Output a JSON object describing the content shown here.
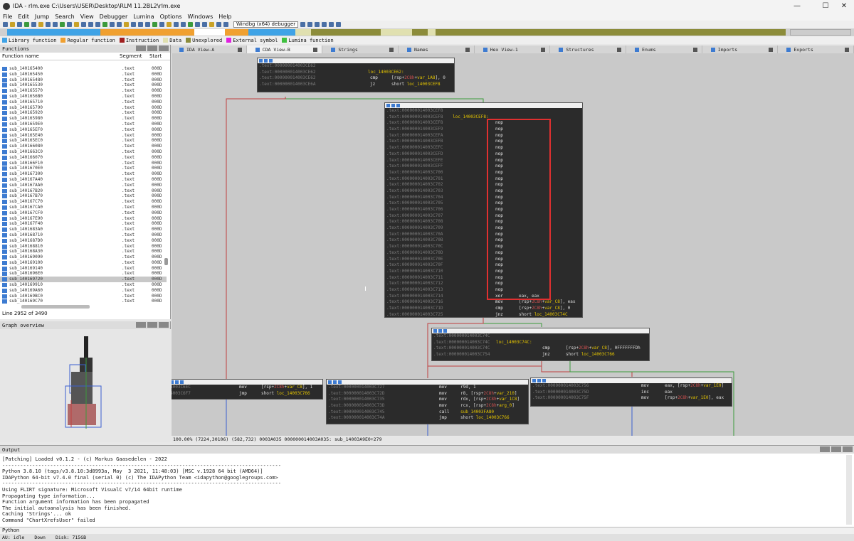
{
  "window": {
    "title": "IDA - rlm.exe C:\\Users\\USER\\Desktop\\RLM 11.2BL2\\rlm.exe",
    "min": "—",
    "max": "☐",
    "close": "✕"
  },
  "menu": [
    "File",
    "Edit",
    "Jump",
    "Search",
    "View",
    "Debugger",
    "Lumina",
    "Options",
    "Windows",
    "Help"
  ],
  "toolbar": {
    "debugger": "Windbg (x64) debugger"
  },
  "legend": [
    {
      "label": "Library function",
      "color": "#3fa3e6"
    },
    {
      "label": "Regular function",
      "color": "#f0a030"
    },
    {
      "label": "Instruction",
      "color": "#a02020"
    },
    {
      "label": "Data",
      "color": "#e0e0b0"
    },
    {
      "label": "Unexplored",
      "color": "#8c8c3a"
    },
    {
      "label": "External symbol",
      "color": "#e020e0"
    },
    {
      "label": "Lumina function",
      "color": "#40c040"
    }
  ],
  "navbar_segments": [
    {
      "w": 12,
      "c": "#3fa3e6"
    },
    {
      "w": 12,
      "c": "#f0a030"
    },
    {
      "w": 4,
      "c": "#ffffff"
    },
    {
      "w": 3,
      "c": "#f0a030"
    },
    {
      "w": 6,
      "c": "#3fa3e6"
    },
    {
      "w": 2,
      "c": "#e0e0b0"
    },
    {
      "w": 9,
      "c": "#8c8c3a"
    },
    {
      "w": 4,
      "c": "#e0e0b0"
    },
    {
      "w": 2,
      "c": "#8c8c3a"
    },
    {
      "w": 1,
      "c": "#e0e0b0"
    },
    {
      "w": 45,
      "c": "#8c8c3a"
    }
  ],
  "tabs": [
    "IDA View-A",
    "CDA View-B",
    "Strings",
    "Names",
    "Hex View-1",
    "Structures",
    "Enums",
    "Imports",
    "Exports"
  ],
  "functions": {
    "title": "Functions",
    "cols": [
      "Function name",
      "Segment",
      "Start"
    ],
    "rows": [
      "sub_140165400",
      "sub_140165450",
      "sub_140165480",
      "sub_140165530",
      "sub_140165570",
      "sub_1401656B0",
      "sub_140165710",
      "sub_140165790",
      "sub_140165920",
      "sub_140165980",
      "sub_1401659E0",
      "sub_140165EF0",
      "sub_140165E40",
      "sub_140165EC0",
      "sub_140166080",
      "sub_1401663C0",
      "sub_140166070",
      "sub_140166F10",
      "sub_1401670E0",
      "sub_140167300",
      "sub_140167A40",
      "sub_140167AA0",
      "sub_140167B20",
      "sub_140167B70",
      "sub_140167C70",
      "sub_140167CA0",
      "sub_140167CF0",
      "sub_140167E90",
      "sub_140167F40",
      "sub_1401683A0",
      "sub_140168710",
      "sub_1401687D0",
      "sub_140168810",
      "sub_140168A30",
      "sub_140169090",
      "sub_140169100",
      "sub_140169140",
      "sub_1401696E0",
      "sub_140169720",
      "sub_140169910",
      "sub_140169A60",
      "sub_140169BC0",
      "sub_140169C70"
    ],
    "segment": ".text",
    "start": "000D",
    "selected": 38,
    "status": "Line 2952 of 3490"
  },
  "graph_overview": {
    "title": "Graph overview"
  },
  "blocks": [
    {
      "id": "b1",
      "lines": [
        {
          "addr": ".text:000000014003CE62"
        },
        {
          "addr": ".text:000000014003CE62",
          "label": "loc_14003CE62:"
        },
        {
          "addr": ".text:000000014003CE62",
          "mn": "cmp",
          "op": "[rsp+2C8h+var_1A8], 0"
        },
        {
          "addr": ".text:000000014003CE6A",
          "mn": "jz",
          "op": "short loc_14003CEF8"
        }
      ]
    },
    {
      "id": "b2",
      "lines": [
        {
          "addr": ".text:000000014003CEF8"
        },
        {
          "addr": ".text:000000014003CEF8",
          "label": "loc_14003CEF8:"
        },
        {
          "addr": ".text:000000014003CEF8",
          "mn": "nop"
        },
        {
          "addr": ".text:000000014003CEF9",
          "mn": "nop"
        },
        {
          "addr": ".text:000000014003CEFA",
          "mn": "nop"
        },
        {
          "addr": ".text:000000014003CEFB",
          "mn": "nop"
        },
        {
          "addr": ".text:000000014003CEFC",
          "mn": "nop"
        },
        {
          "addr": ".text:000000014003CEFD",
          "mn": "nop"
        },
        {
          "addr": ".text:000000014003CEFE",
          "mn": "nop"
        },
        {
          "addr": ".text:000000014003CEFF",
          "mn": "nop"
        },
        {
          "addr": ".text:000000014003C700",
          "mn": "nop"
        },
        {
          "addr": ".text:000000014003C701",
          "mn": "nop"
        },
        {
          "addr": ".text:000000014003C702",
          "mn": "nop"
        },
        {
          "addr": ".text:000000014003C703",
          "mn": "nop"
        },
        {
          "addr": ".text:000000014003C704",
          "mn": "nop"
        },
        {
          "addr": ".text:000000014003C705",
          "mn": "nop"
        },
        {
          "addr": ".text:000000014003C706",
          "mn": "nop"
        },
        {
          "addr": ".text:000000014003C707",
          "mn": "nop"
        },
        {
          "addr": ".text:000000014003C708",
          "mn": "nop"
        },
        {
          "addr": ".text:000000014003C709",
          "mn": "nop"
        },
        {
          "addr": ".text:000000014003C70A",
          "mn": "nop"
        },
        {
          "addr": ".text:000000014003C70B",
          "mn": "nop"
        },
        {
          "addr": ".text:000000014003C70C",
          "mn": "nop"
        },
        {
          "addr": ".text:000000014003C70D",
          "mn": "nop"
        },
        {
          "addr": ".text:000000014003C70E",
          "mn": "nop"
        },
        {
          "addr": ".text:000000014003C70F",
          "mn": "nop"
        },
        {
          "addr": ".text:000000014003C710",
          "mn": "nop"
        },
        {
          "addr": ".text:000000014003C711",
          "mn": "nop"
        },
        {
          "addr": ".text:000000014003C712",
          "mn": "nop"
        },
        {
          "addr": ".text:000000014003C713",
          "mn": "nop"
        },
        {
          "addr": ".text:000000014003C714",
          "mn": "xor",
          "op": "eax, eax"
        },
        {
          "addr": ".text:000000014003C716",
          "mn": "mov",
          "op": "[rsp+2C8h+var_C8], eax"
        },
        {
          "addr": ".text:000000014003C71D",
          "mn": "cmp",
          "op": "[rsp+2C8h+var_C8], 0"
        },
        {
          "addr": ".text:000000014003C725",
          "mn": "jnz",
          "op": "short loc_14003C74C"
        }
      ]
    },
    {
      "id": "b3",
      "lines": [
        {
          "addr": ".text:000000014003C74C"
        },
        {
          "addr": ".text:000000014003C74C",
          "label": "loc_14003C74C:"
        },
        {
          "addr": ".text:000000014003C74C",
          "mn": "cmp",
          "op": "[rsp+2C8h+var_C8], 0FFFFFFFDh"
        },
        {
          "addr": ".text:000000014003C754",
          "mn": "jnz",
          "op": "short loc_14003C766"
        }
      ]
    },
    {
      "id": "b4",
      "lines": [
        {
          "addr": "4003C6EC",
          "mn": "mov",
          "op": "[rsp+2C8h+var_C8], 1"
        },
        {
          "addr": "4003C6F7",
          "mn": "jmp",
          "op": "short loc_14003C766"
        }
      ]
    },
    {
      "id": "b5",
      "lines": [
        {
          "addr": ".text:000000014003C727",
          "mn": "mov",
          "op": "r9d, 1"
        },
        {
          "addr": ".text:000000014003C72D",
          "mn": "mov",
          "op": "r8, [rsp+2C8h+var_210]"
        },
        {
          "addr": ".text:000000014003C735",
          "mn": "mov",
          "op": "rdx, [rsp+2C8h+var_1C8]"
        },
        {
          "addr": ".text:000000014003C73D",
          "mn": "mov",
          "op": "rcx, [rsp+2C8h+arg_0]"
        },
        {
          "addr": ".text:000000014003C745",
          "mn": "call",
          "op": "sub_14003FA80"
        },
        {
          "addr": ".text:000000014003C74A",
          "mn": "jmp",
          "op": "short loc_14003C766"
        }
      ]
    },
    {
      "id": "b6",
      "lines": [
        {
          "addr": ".text:000000014003C756",
          "mn": "mov",
          "op": "eax, [rsp+2C8h+var_1E0]"
        },
        {
          "addr": ".text:000000014003C75D",
          "mn": "inc",
          "op": "eax"
        },
        {
          "addr": ".text:000000014003C75F",
          "mn": "mov",
          "op": "[rsp+2C8h+var_1E0], eax"
        }
      ]
    }
  ],
  "graph_status": "100.00% (7224,30106) (582,732) 0003A035 000000014003A035: sub_14003A9E0+279",
  "output": {
    "title": "Output",
    "text": "[Patching] Loaded v0.1.2 - (c) Markus Gaasedelen - 2022\n---------------------------------------------------------------------------------------------\nPython 3.8.10 (tags/v3.8.10:3d8993a, May  3 2021, 11:48:03) [MSC v.1928 64 bit (AMD64)]\nIDAPython 64-bit v7.4.0 final (serial 0) (c) The IDAPython Team <idapython@googlegroups.com>\n---------------------------------------------------------------------------------------------\nUsing FLIRT signature: Microsoft VisualC v7/14 64bit runtime\nPropagating type information...\nFunction argument information has been propagated\nThe initial autoanalysis has been finished.\nCaching 'Strings'... ok\nCommand \"ChartXrefsUser\" failed"
  },
  "python_label": "Python",
  "status": [
    "AU:  idle",
    "Down",
    "Disk: 715GB"
  ]
}
